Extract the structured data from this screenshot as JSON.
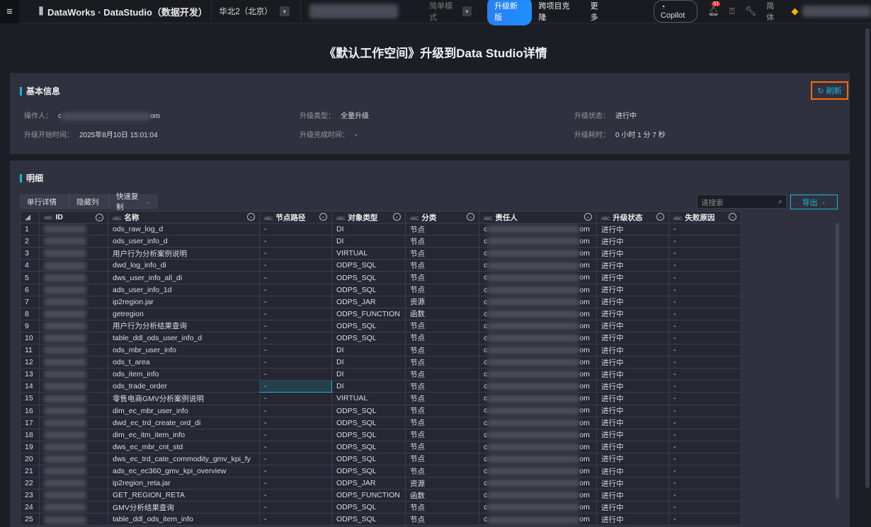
{
  "topbar": {
    "brand": "DataWorks · DataStudio（数据开发）",
    "region": "华北2（北京）",
    "mode": "简单模式",
    "upgrade": "升级新版",
    "cross": "跨项目克隆",
    "more": "更多",
    "copilot": "Copilot",
    "notif_count": "51",
    "lang": "简体"
  },
  "page_title": "《默认工作空间》升级到Data Studio详情",
  "basic": {
    "title": "基本信息",
    "refresh": "刷新",
    "operator_label": "操作人：",
    "operator_prefix": "c",
    "operator_suffix": "om",
    "type_label": "升级类型：",
    "type_value": "全量升级",
    "status_label": "升级状态：",
    "status_value": "进行中",
    "start_label": "升级开始时间：",
    "start_value": "2025年8月10日 15:01:04",
    "end_label": "升级完成时间：",
    "end_value": "-",
    "duration_label": "升级耗时：",
    "duration_value": "0 小时 1 分 7 秒"
  },
  "detail": {
    "title": "明细",
    "btn_row": "单行详情",
    "btn_hide": "隐藏列",
    "btn_copy": "快速复制",
    "search_placeholder": "请搜索",
    "export": "导出",
    "type_tag": "ABC",
    "columns": [
      "ID",
      "名称",
      "节点路径",
      "对象类型",
      "分类",
      "责任人",
      "升级状态",
      "失败原因"
    ],
    "rows": [
      [
        "ods_raw_log_d",
        "DI",
        "节点"
      ],
      [
        "ods_user_info_d",
        "DI",
        "节点"
      ],
      [
        "用户行为分析案例说明",
        "VIRTUAL",
        "节点"
      ],
      [
        "dwd_log_info_di",
        "ODPS_SQL",
        "节点"
      ],
      [
        "dws_user_info_all_di",
        "ODPS_SQL",
        "节点"
      ],
      [
        "ads_user_info_1d",
        "ODPS_SQL",
        "节点"
      ],
      [
        "ip2region.jar",
        "ODPS_JAR",
        "资源"
      ],
      [
        "getregion",
        "ODPS_FUNCTION",
        "函数"
      ],
      [
        "用户行为分析结果查询",
        "ODPS_SQL",
        "节点"
      ],
      [
        "table_ddl_ods_user_info_d",
        "ODPS_SQL",
        "节点"
      ],
      [
        "ods_mbr_user_info",
        "DI",
        "节点"
      ],
      [
        "ods_t_area",
        "DI",
        "节点"
      ],
      [
        "ods_item_info",
        "DI",
        "节点"
      ],
      [
        "ods_trade_order",
        "DI",
        "节点"
      ],
      [
        "零售电商GMV分析案例说明",
        "VIRTUAL",
        "节点"
      ],
      [
        "dim_ec_mbr_user_info",
        "ODPS_SQL",
        "节点"
      ],
      [
        "dwd_ec_trd_create_ord_di",
        "ODPS_SQL",
        "节点"
      ],
      [
        "dim_ec_itm_item_info",
        "ODPS_SQL",
        "节点"
      ],
      [
        "dws_ec_mbr_cnt_std",
        "ODPS_SQL",
        "节点"
      ],
      [
        "dws_ec_trd_cate_commodity_gmv_kpi_fy",
        "ODPS_SQL",
        "节点"
      ],
      [
        "ads_ec_ec360_gmv_kpi_overview",
        "ODPS_SQL",
        "节点"
      ],
      [
        "ip2region_reta.jar",
        "ODPS_JAR",
        "资源"
      ],
      [
        "GET_REGION_RETA",
        "ODPS_FUNCTION",
        "函数"
      ],
      [
        "GMV分析结果查询",
        "ODPS_SQL",
        "节点"
      ],
      [
        "table_ddl_ods_item_info",
        "ODPS_SQL",
        "节点"
      ]
    ],
    "path_value": "-",
    "owner_prefix": "c",
    "owner_suffix": "om",
    "status_value": "进行中",
    "reason_value": "-"
  }
}
